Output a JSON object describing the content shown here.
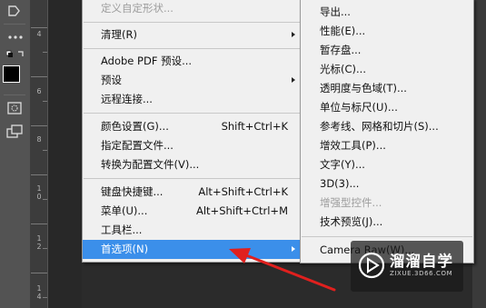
{
  "ruler": {
    "labels": [
      "4",
      "6",
      "8",
      "1 0",
      "1 2",
      "1 4"
    ]
  },
  "main_menu": {
    "items": [
      {
        "label": "定义自定形状...",
        "disabled": true
      },
      {
        "label": "清理(R)",
        "submenu": true
      },
      {
        "label": "Adobe PDF 预设..."
      },
      {
        "label": "预设",
        "submenu": true
      },
      {
        "label": "远程连接..."
      },
      {
        "label": "颜色设置(G)...",
        "shortcut": "Shift+Ctrl+K"
      },
      {
        "label": "指定配置文件..."
      },
      {
        "label": "转换为配置文件(V)..."
      },
      {
        "label": "键盘快捷键...",
        "shortcut": "Alt+Shift+Ctrl+K"
      },
      {
        "label": "菜单(U)...",
        "shortcut": "Alt+Shift+Ctrl+M"
      },
      {
        "label": "工具栏..."
      },
      {
        "label": "首选项(N)",
        "submenu": true,
        "active": true
      }
    ]
  },
  "submenu": {
    "items": [
      {
        "label": "导出..."
      },
      {
        "label": "性能(E)..."
      },
      {
        "label": "暂存盘..."
      },
      {
        "label": "光标(C)..."
      },
      {
        "label": "透明度与色域(T)..."
      },
      {
        "label": "单位与标尺(U)..."
      },
      {
        "label": "参考线、网格和切片(S)..."
      },
      {
        "label": "增效工具(P)..."
      },
      {
        "label": "文字(Y)..."
      },
      {
        "label": "3D(3)..."
      },
      {
        "label": "增强型控件...",
        "disabled": true
      },
      {
        "label": "技术预览(J)..."
      },
      {
        "label": "Camera Raw(W)..."
      }
    ]
  },
  "watermark": {
    "title": "溜溜自学",
    "subtitle": "ZIXUE.3D66.COM"
  },
  "colors": {
    "highlight": "#3b8fea",
    "arrow": "#e0201e",
    "menu_bg": "#f0f0f0",
    "panel": "#535353"
  }
}
